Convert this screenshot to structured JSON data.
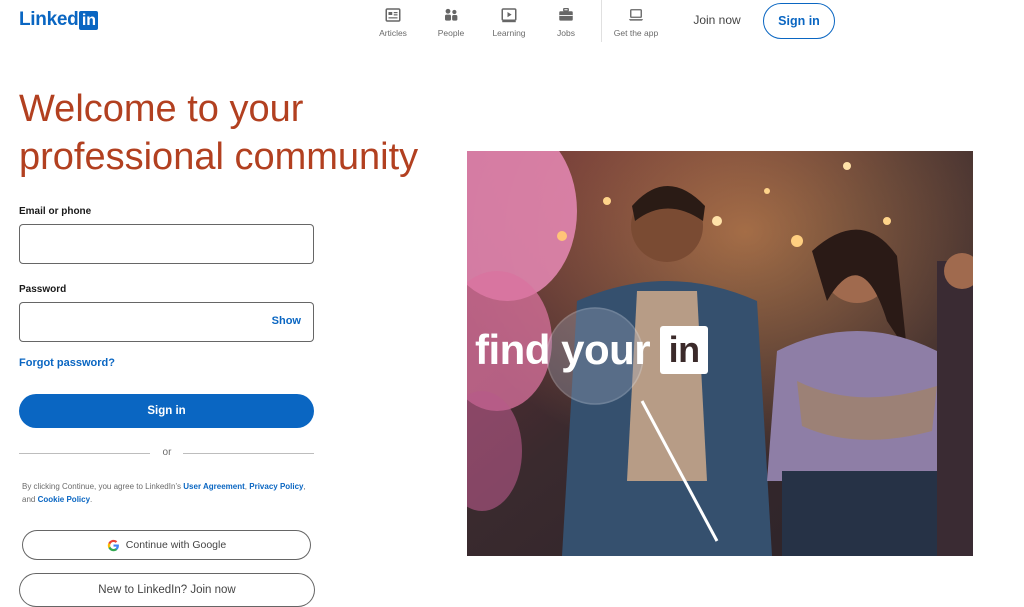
{
  "brand": {
    "logo_text": "Linked",
    "logo_box": "in",
    "color": "#0a66c2",
    "accent": "#b24020"
  },
  "nav": {
    "items": [
      {
        "label": "Articles",
        "icon": "articles-icon"
      },
      {
        "label": "People",
        "icon": "people-icon"
      },
      {
        "label": "Learning",
        "icon": "learning-icon"
      },
      {
        "label": "Jobs",
        "icon": "jobs-icon"
      },
      {
        "label": "Get the app",
        "icon": "laptop-icon"
      }
    ],
    "join_now": "Join now",
    "sign_in": "Sign in"
  },
  "hero": {
    "title_line1": "Welcome to your",
    "title_line2": "professional community",
    "overlay_text": "find your",
    "overlay_box": "in"
  },
  "form": {
    "email_label": "Email or phone",
    "email_value": "",
    "password_label": "Password",
    "password_value": "",
    "show_label": "Show",
    "forgot": "Forgot password?",
    "sign_in": "Sign in",
    "or": "or",
    "legal_prefix": "By clicking Continue, you agree to LinkedIn’s ",
    "legal_user_agreement": "User Agreement",
    "legal_comma": ", ",
    "legal_privacy": "Privacy Policy",
    "legal_and": ", and ",
    "legal_cookie": "Cookie Policy",
    "legal_end": ".",
    "google": "Continue with Google",
    "join": "New to LinkedIn? Join now"
  }
}
